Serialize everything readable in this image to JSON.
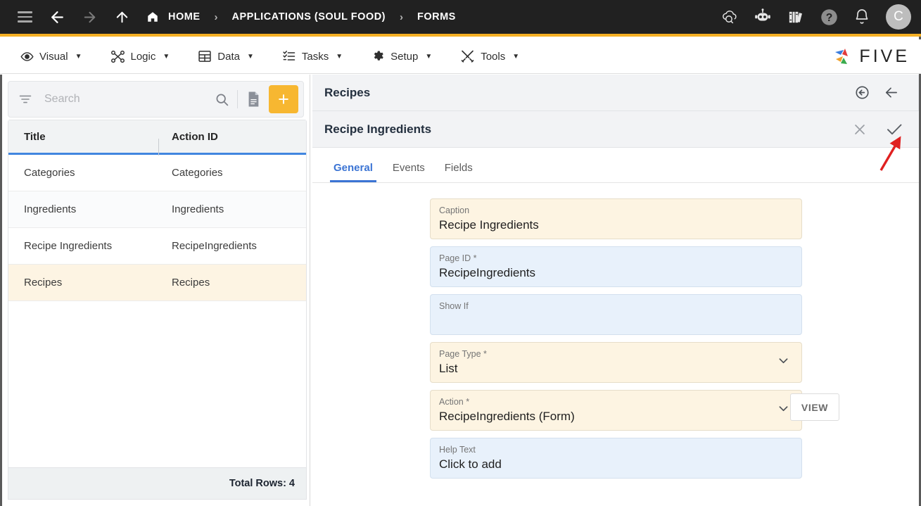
{
  "topbar": {
    "nav_icons": [
      "hamburger-icon",
      "back-arrow-icon",
      "forward-arrow-icon",
      "up-arrow-icon"
    ],
    "breadcrumbs": [
      {
        "label": "HOME",
        "icon": "home-icon"
      },
      {
        "label": "APPLICATIONS (SOUL FOOD)"
      },
      {
        "label": "FORMS"
      }
    ],
    "separator": "›",
    "right_icons": [
      "cloud-check-icon",
      "robot-chat-icon",
      "library-books-icon",
      "help-icon",
      "bell-icon"
    ],
    "avatar_initial": "C",
    "accent_color": "#f5b024",
    "background_color": "#212121"
  },
  "menubar": {
    "items": [
      {
        "label": "Visual",
        "icon": "eye-icon"
      },
      {
        "label": "Logic",
        "icon": "flow-nodes-icon"
      },
      {
        "label": "Data",
        "icon": "table-grid-icon"
      },
      {
        "label": "Tasks",
        "icon": "checklist-icon"
      },
      {
        "label": "Setup",
        "icon": "gear-icon"
      },
      {
        "label": "Tools",
        "icon": "tools-icon"
      }
    ],
    "caret": "▼",
    "brand": "FIVE"
  },
  "sidebar": {
    "search": {
      "placeholder": "Search",
      "value": ""
    },
    "filter_icon": "filter-icon",
    "search_icon": "search-icon",
    "document_icon": "document-icon",
    "add_label": "+",
    "grid": {
      "columns": [
        "Title",
        "Action ID"
      ],
      "rows": [
        {
          "title": "Categories",
          "action_id": "Categories",
          "selected": false
        },
        {
          "title": "Ingredients",
          "action_id": "Ingredients",
          "selected": false
        },
        {
          "title": "Recipe Ingredients",
          "action_id": "RecipeIngredients",
          "selected": false
        },
        {
          "title": "Recipes",
          "action_id": "Recipes",
          "selected": true
        }
      ],
      "total_rows_label": "Total Rows: 4"
    }
  },
  "detail": {
    "parent_title": "Recipes",
    "parent_icons": [
      "back-circle-icon",
      "left-arrow-icon"
    ],
    "record_title": "Recipe Ingredients",
    "record_icons": [
      "close-icon",
      "confirm-check-icon"
    ],
    "tabs": [
      {
        "label": "General",
        "active": true
      },
      {
        "label": "Events",
        "active": false
      },
      {
        "label": "Fields",
        "active": false
      }
    ],
    "fields": [
      {
        "label": "Caption",
        "value": "Recipe Ingredients",
        "style": "amber",
        "dropdown": false
      },
      {
        "label": "Page ID *",
        "value": "RecipeIngredients",
        "style": "blue",
        "dropdown": false
      },
      {
        "label": "Show If",
        "value": "",
        "style": "blue",
        "dropdown": false
      },
      {
        "label": "Page Type *",
        "value": "List",
        "style": "amber",
        "dropdown": true
      },
      {
        "label": "Action *",
        "value": "RecipeIngredients (Form)",
        "style": "amber",
        "dropdown": true
      },
      {
        "label": "Help Text",
        "value": "Click to add",
        "style": "blue",
        "dropdown": false
      }
    ],
    "view_button": "VIEW",
    "annotation": {
      "type": "red-arrow",
      "color": "#e02020",
      "points_to": "confirm-check-icon"
    }
  }
}
